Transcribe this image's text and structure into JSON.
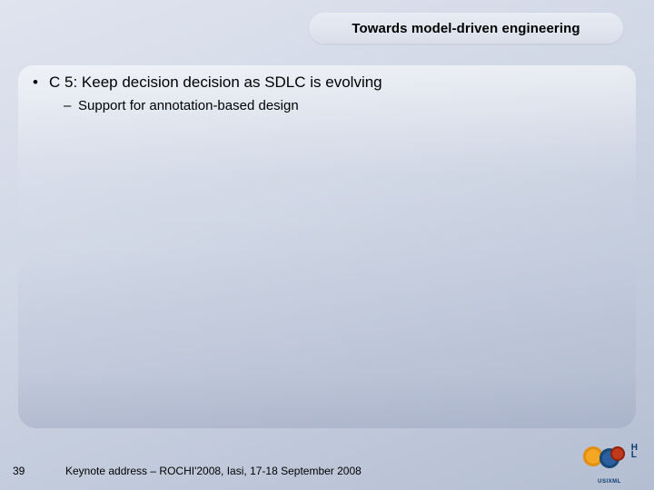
{
  "header": {
    "title": "Towards model-driven engineering"
  },
  "body": {
    "bullets": [
      {
        "level": 1,
        "text": "C 5: Keep decision decision as SDLC is evolving"
      },
      {
        "level": 2,
        "text": "Support for annotation-based design"
      }
    ]
  },
  "footer": {
    "slide_number": "39",
    "text": "Keynote address – ROCHI'2008, Iasi, 17-18 September 2008"
  },
  "logo": {
    "name": "usixml-logo",
    "label": "USIXML"
  }
}
